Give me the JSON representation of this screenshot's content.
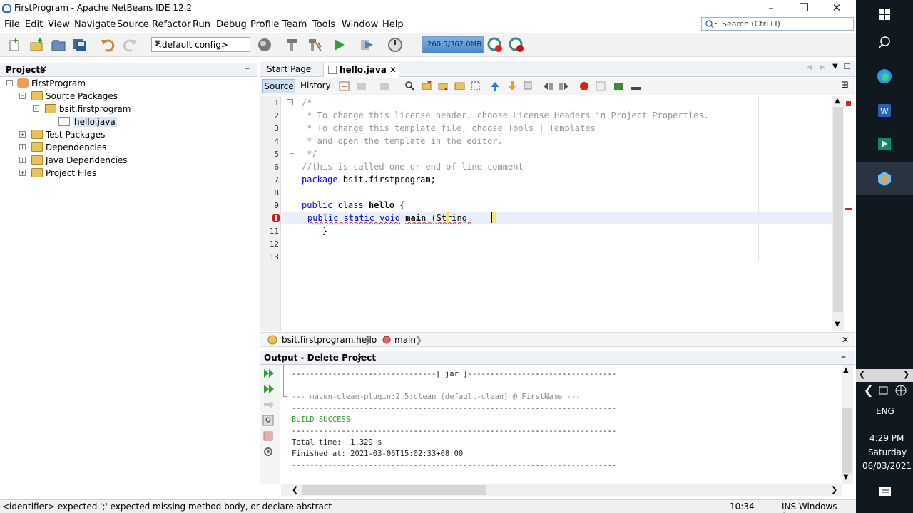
{
  "window": {
    "title": "FirstProgram - Apache NetBeans IDE 12.2"
  },
  "menu": [
    "File",
    "Edit",
    "View",
    "Navigate",
    "Source",
    "Refactor",
    "Run",
    "Debug",
    "Profile",
    "Team",
    "Tools",
    "Window",
    "Help"
  ],
  "search": {
    "placeholder": "Search (Ctrl+I)"
  },
  "toolbar": {
    "config": "<default config>",
    "memory": "260.5/362.0MB"
  },
  "projects": {
    "title": "Projects",
    "root": "FirstProgram",
    "source_packages": "Source Packages",
    "package": "bsit.firstprogram",
    "file": "hello.java",
    "test_packages": "Test Packages",
    "dependencies": "Dependencies",
    "java_dependencies": "Java Dependencies",
    "project_files": "Project Files"
  },
  "editor": {
    "tabs": [
      "Start Page",
      "hello.java"
    ],
    "source_label": "Source",
    "history_label": "History",
    "line_numbers": [
      "1",
      "2",
      "3",
      "4",
      "5",
      "6",
      "7",
      "8",
      "9",
      "10",
      "11",
      "12",
      "13"
    ],
    "lines": {
      "l1": "/*",
      "l2": " * To change this license header, choose License Headers in Project Properties.",
      "l3": " * To change this template file, choose Tools | Templates",
      "l4": " * and open the template in the editor.",
      "l5": " */",
      "l6": "//this is called one or end of line comment",
      "l7_kw": "package",
      "l7_rest": " bsit.firstprogram;",
      "l9_kw": "public class",
      "l9_name": "hello",
      "l9_rest": " {",
      "l10_kw": "public static void",
      "l10_name": "main",
      "l10_rest": " (String ",
      "l11": "    }"
    }
  },
  "breadcrumb": {
    "class": "bsit.firstprogram.hello",
    "method": "main"
  },
  "output": {
    "title": "Output - Delete Project",
    "lines": {
      "o1": "--------------------------------[ jar ]---------------------------------",
      "o2": "--- maven-clean-plugin:2.5:clean (default-clean) @ FirstName ---",
      "o3": "------------------------------------------------------------------------",
      "o4": "BUILD SUCCESS",
      "o5": "------------------------------------------------------------------------",
      "o6": "Total time:  1.329 s",
      "o7": "Finished at: 2021-03-06T15:02:33+08:00",
      "o8": "------------------------------------------------------------------------"
    }
  },
  "status": {
    "message": "<identifier> expected  ';' expected  missing method body, or declare abstract",
    "position": "10:34",
    "mode": "INS Windows (CR..."
  },
  "taskbar": {
    "language": "ENG",
    "time": "4:29 PM",
    "day": "Saturday",
    "date": "06/03/2021"
  }
}
